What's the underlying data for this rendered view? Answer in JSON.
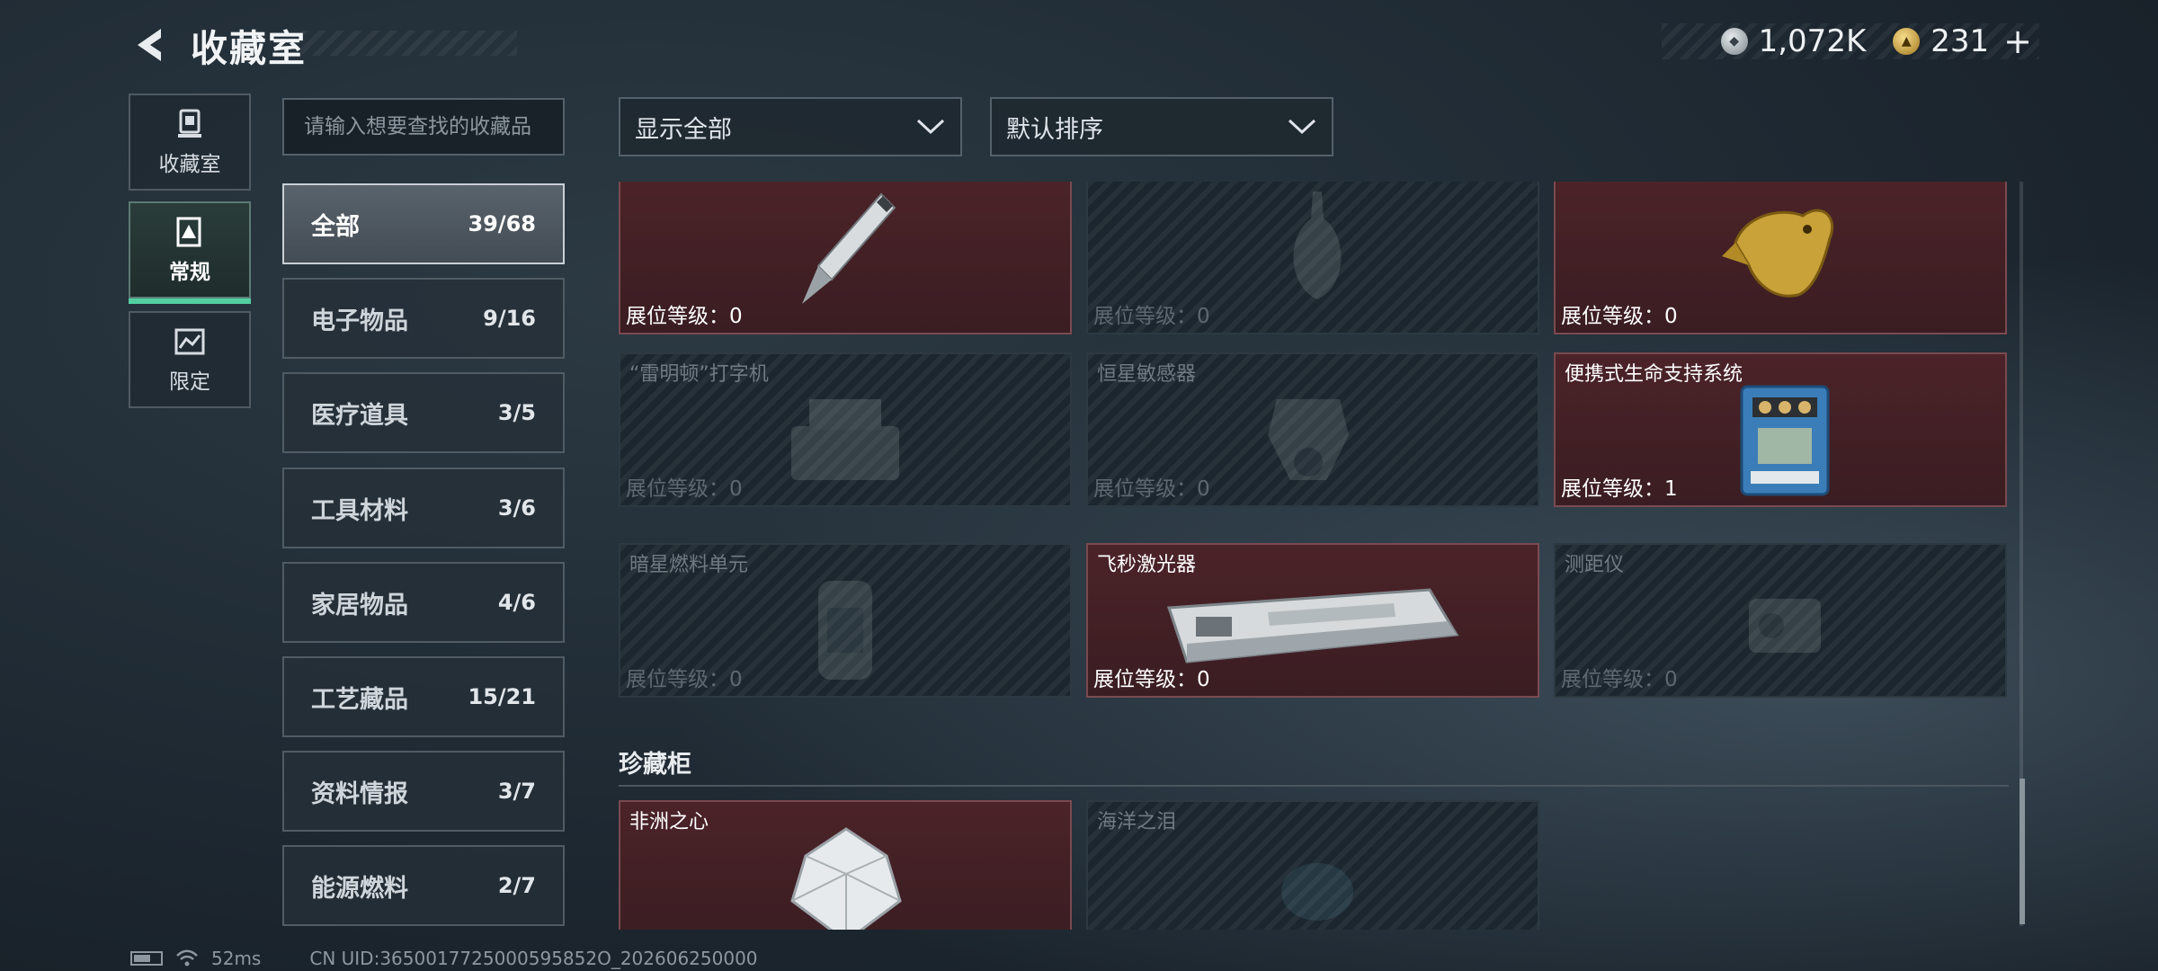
{
  "header": {
    "title": "收藏室"
  },
  "currency": {
    "silver_amount": "1,072K",
    "gold_amount": "231",
    "add_symbol": "+"
  },
  "left_nav": [
    {
      "label": "收藏室",
      "icon": "trophy-icon",
      "active": false
    },
    {
      "label": "常规",
      "icon": "warning-icon",
      "active": true
    },
    {
      "label": "限定",
      "icon": "map-icon",
      "active": false
    }
  ],
  "search": {
    "placeholder": "请输入想要查找的收藏品"
  },
  "categories": [
    {
      "name": "全部",
      "count": "39/68",
      "active": true
    },
    {
      "name": "电子物品",
      "count": "9/16"
    },
    {
      "name": "医疗道具",
      "count": "3/5"
    },
    {
      "name": "工具材料",
      "count": "3/6"
    },
    {
      "name": "家居物品",
      "count": "4/6"
    },
    {
      "name": "工艺藏品",
      "count": "15/21"
    },
    {
      "name": "资料情报",
      "count": "3/7"
    },
    {
      "name": "能源燃料",
      "count": "2/7"
    }
  ],
  "filters": {
    "display": "显示全部",
    "sort": "默认排序"
  },
  "items": [
    {
      "name": "",
      "level_text": "展位等级：0",
      "owned": true,
      "icon": "pen-icon"
    },
    {
      "name": "",
      "level_text": "展位等级：0",
      "owned": false,
      "icon": "vase-icon"
    },
    {
      "name": "",
      "level_text": "展位等级：0",
      "owned": true,
      "icon": "golden-crocodile-icon"
    },
    {
      "name": "“雷明顿”打字机",
      "level_text": "展位等级：0",
      "owned": false,
      "icon": "typewriter-icon"
    },
    {
      "name": "恒星敏感器",
      "level_text": "展位等级：0",
      "owned": false,
      "icon": "sensor-icon"
    },
    {
      "name": "便携式生命支持系统",
      "level_text": "展位等级：1",
      "owned": true,
      "icon": "life-support-icon"
    },
    {
      "name": "暗星燃料单元",
      "level_text": "展位等级：0",
      "owned": false,
      "icon": "fuel-cell-icon"
    },
    {
      "name": "飞秒激光器",
      "level_text": "展位等级：0",
      "owned": true,
      "icon": "laser-icon"
    },
    {
      "name": "测距仪",
      "level_text": "展位等级：0",
      "owned": false,
      "icon": "rangefinder-icon"
    }
  ],
  "showcase": {
    "title": "珍藏柜",
    "items": [
      {
        "name": "非洲之心",
        "owned": true,
        "icon": "diamond-icon"
      },
      {
        "name": "海洋之泪",
        "owned": false,
        "icon": "gem-icon"
      }
    ]
  },
  "status_bar": {
    "ping": "52ms",
    "uid": "CN UID:3650017725000595852O_202606250000"
  },
  "colors": {
    "accent": "#53d0a2",
    "owned_card": "#4b2328",
    "locked_card": "#1b262e"
  }
}
